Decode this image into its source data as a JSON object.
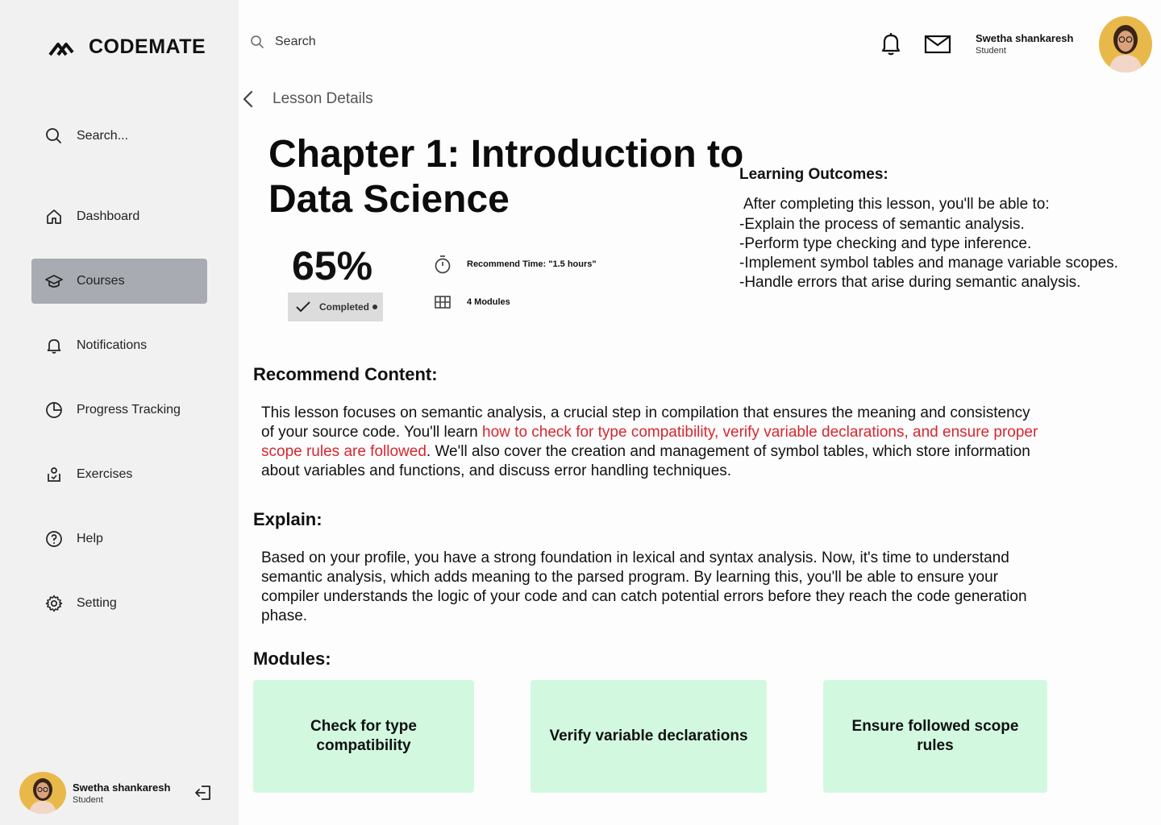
{
  "brand": {
    "name": "CODEMATE"
  },
  "sidebar": {
    "search_placeholder": "Search...",
    "items": [
      {
        "label": "Dashboard",
        "icon": "home-icon"
      },
      {
        "label": "Courses",
        "icon": "graduation-cap-icon",
        "active": true
      },
      {
        "label": "Notifications",
        "icon": "bell-icon"
      },
      {
        "label": "Progress Tracking",
        "icon": "pie-chart-icon"
      },
      {
        "label": "Exercises",
        "icon": "exercise-icon"
      },
      {
        "label": "Help",
        "icon": "help-icon"
      },
      {
        "label": "Setting",
        "icon": "gear-icon"
      }
    ],
    "user": {
      "name": "Swetha shankaresh",
      "role": "Student"
    }
  },
  "topbar": {
    "search_label": "Search",
    "user": {
      "name": "Swetha shankaresh",
      "role": "Student"
    }
  },
  "breadcrumb": {
    "label": "Lesson Details"
  },
  "lesson": {
    "title": "Chapter 1: Introduction to Data Science",
    "progress_percent": "65%",
    "status": "Completed",
    "recommend_time": "Recommend Time: \"1.5 hours\"",
    "modules_count": "4  Modules"
  },
  "learning_outcomes": {
    "heading": "Learning Outcomes:",
    "intro": "After completing this lesson, you'll be able to:",
    "items": [
      "-Explain the process of semantic analysis.",
      "-Perform type checking and type inference.",
      "-Implement symbol tables and manage variable scopes.",
      "-Handle errors that arise during semantic analysis."
    ]
  },
  "recommend": {
    "heading": "Recommend Content:",
    "text_before": "This lesson focuses on semantic analysis, a crucial step in compilation that ensures the meaning and consistency of your source code. You'll learn ",
    "text_highlight": "how to check for type compatibility, verify variable declarations, and ensure proper scope rules are followed",
    "text_after": ". We'll also cover the creation and management of symbol tables, which store information about variables and functions, and discuss error handling techniques."
  },
  "explain": {
    "heading": "Explain:",
    "text": "Based on your profile, you have a strong foundation in lexical and syntax analysis. Now, it's time to understand semantic analysis, which adds meaning to the parsed program. By learning this, you'll be able to ensure your compiler understands the logic of your code and can catch potential errors before they reach the code generation phase."
  },
  "modules": {
    "heading": "Modules:",
    "items": [
      "Check for type compatibility",
      "Verify variable declarations",
      "Ensure followed scope rules"
    ]
  },
  "colors": {
    "accent_red": "#d8262e",
    "module_bg": "#d2f9e0",
    "active_nav": "#a8acb2"
  }
}
